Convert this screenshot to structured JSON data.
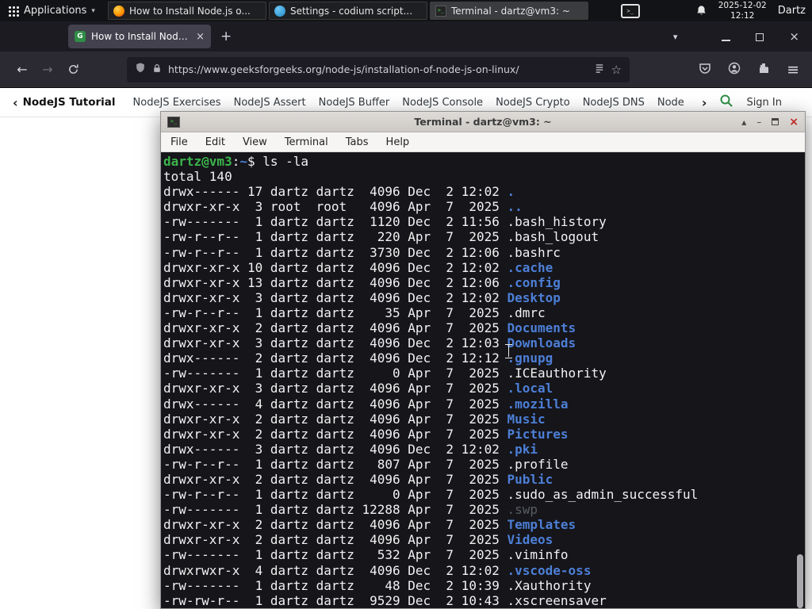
{
  "panel": {
    "applications": "Applications",
    "tasks": [
      {
        "title": "How to Install Node.js o...",
        "icon": "firefox",
        "active": false
      },
      {
        "title": "Settings - codium script...",
        "icon": "codium",
        "active": false
      },
      {
        "title": "Terminal - dartz@vm3: ~",
        "icon": "terminal",
        "active": true
      }
    ],
    "clock": {
      "date": "2025-12-02",
      "time": "12:12"
    },
    "user": "Dartz"
  },
  "browser": {
    "tab": {
      "title": "How to Install Node.js on"
    },
    "nav": {
      "url": "https://www.geeksforgeeks.org/node-js/installation-of-node-js-on-linux/"
    },
    "site_nav": {
      "tutorial": "NodeJS Tutorial",
      "links": [
        "NodeJS Exercises",
        "NodeJS Assert",
        "NodeJS Buffer",
        "NodeJS Console",
        "NodeJS Crypto",
        "NodeJS DNS",
        "Node"
      ],
      "sign_in": "Sign In"
    }
  },
  "terminal": {
    "title": "Terminal - dartz@vm3: ~",
    "menus": [
      "File",
      "Edit",
      "View",
      "Terminal",
      "Tabs",
      "Help"
    ],
    "prompt": {
      "userhost": "dartz@vm3",
      "colon": ":",
      "path": "~",
      "symbol": "$ "
    },
    "command": "ls -la",
    "total": "total 140",
    "listing": [
      {
        "meta": "drwx------ 17 dartz dartz  4096 Dec  2 12:02 ",
        "name": ".",
        "kind": "dir"
      },
      {
        "meta": "drwxr-xr-x  3 root  root   4096 Apr  7  2025 ",
        "name": "..",
        "kind": "dir"
      },
      {
        "meta": "-rw-------  1 dartz dartz  1120 Dec  2 11:56 ",
        "name": ".bash_history",
        "kind": "file"
      },
      {
        "meta": "-rw-r--r--  1 dartz dartz   220 Apr  7  2025 ",
        "name": ".bash_logout",
        "kind": "file"
      },
      {
        "meta": "-rw-r--r--  1 dartz dartz  3730 Dec  2 12:06 ",
        "name": ".bashrc",
        "kind": "file"
      },
      {
        "meta": "drwxr-xr-x 10 dartz dartz  4096 Dec  2 12:02 ",
        "name": ".cache",
        "kind": "dir"
      },
      {
        "meta": "drwxr-xr-x 13 dartz dartz  4096 Dec  2 12:06 ",
        "name": ".config",
        "kind": "dir"
      },
      {
        "meta": "drwxr-xr-x  3 dartz dartz  4096 Dec  2 12:02 ",
        "name": "Desktop",
        "kind": "dir"
      },
      {
        "meta": "-rw-r--r--  1 dartz dartz    35 Apr  7  2025 ",
        "name": ".dmrc",
        "kind": "file"
      },
      {
        "meta": "drwxr-xr-x  2 dartz dartz  4096 Apr  7  2025 ",
        "name": "Documents",
        "kind": "dir"
      },
      {
        "meta": "drwxr-xr-x  3 dartz dartz  4096 Dec  2 12:03 ",
        "name": "Downloads",
        "kind": "dir"
      },
      {
        "meta": "drwx------  2 dartz dartz  4096 Dec  2 12:12 ",
        "name": ".gnupg",
        "kind": "dir"
      },
      {
        "meta": "-rw-------  1 dartz dartz     0 Apr  7  2025 ",
        "name": ".ICEauthority",
        "kind": "file"
      },
      {
        "meta": "drwxr-xr-x  3 dartz dartz  4096 Apr  7  2025 ",
        "name": ".local",
        "kind": "dir"
      },
      {
        "meta": "drwx------  4 dartz dartz  4096 Apr  7  2025 ",
        "name": ".mozilla",
        "kind": "dir"
      },
      {
        "meta": "drwxr-xr-x  2 dartz dartz  4096 Apr  7  2025 ",
        "name": "Music",
        "kind": "dir"
      },
      {
        "meta": "drwxr-xr-x  2 dartz dartz  4096 Apr  7  2025 ",
        "name": "Pictures",
        "kind": "dir"
      },
      {
        "meta": "drwx------  3 dartz dartz  4096 Dec  2 12:02 ",
        "name": ".pki",
        "kind": "dir"
      },
      {
        "meta": "-rw-r--r--  1 dartz dartz   807 Apr  7  2025 ",
        "name": ".profile",
        "kind": "file"
      },
      {
        "meta": "drwxr-xr-x  2 dartz dartz  4096 Apr  7  2025 ",
        "name": "Public",
        "kind": "dir"
      },
      {
        "meta": "-rw-r--r--  1 dartz dartz     0 Apr  7  2025 ",
        "name": ".sudo_as_admin_successful",
        "kind": "file"
      },
      {
        "meta": "-rw-------  1 dartz dartz 12288 Apr  7  2025 ",
        "name": ".swp",
        "kind": "dim"
      },
      {
        "meta": "drwxr-xr-x  2 dartz dartz  4096 Apr  7  2025 ",
        "name": "Templates",
        "kind": "dir"
      },
      {
        "meta": "drwxr-xr-x  2 dartz dartz  4096 Apr  7  2025 ",
        "name": "Videos",
        "kind": "dir"
      },
      {
        "meta": "-rw-------  1 dartz dartz   532 Apr  7  2025 ",
        "name": ".viminfo",
        "kind": "file"
      },
      {
        "meta": "drwxrwxr-x  4 dartz dartz  4096 Dec  2 12:02 ",
        "name": ".vscode-oss",
        "kind": "dir"
      },
      {
        "meta": "-rw-------  1 dartz dartz    48 Dec  2 10:39 ",
        "name": ".Xauthority",
        "kind": "file"
      },
      {
        "meta": "-rw-rw-r--  1 dartz dartz  9529 Dec  2 10:43 ",
        "name": ".xscreensaver",
        "kind": "file"
      }
    ]
  },
  "colors": {
    "accent_green": "#2f8d46",
    "prompt_green": "#3cb44b",
    "dir_blue": "#4d7fd6",
    "close_red": "#c0281f",
    "panel_bg": "#121316",
    "terminal_bg": "#15151a"
  }
}
